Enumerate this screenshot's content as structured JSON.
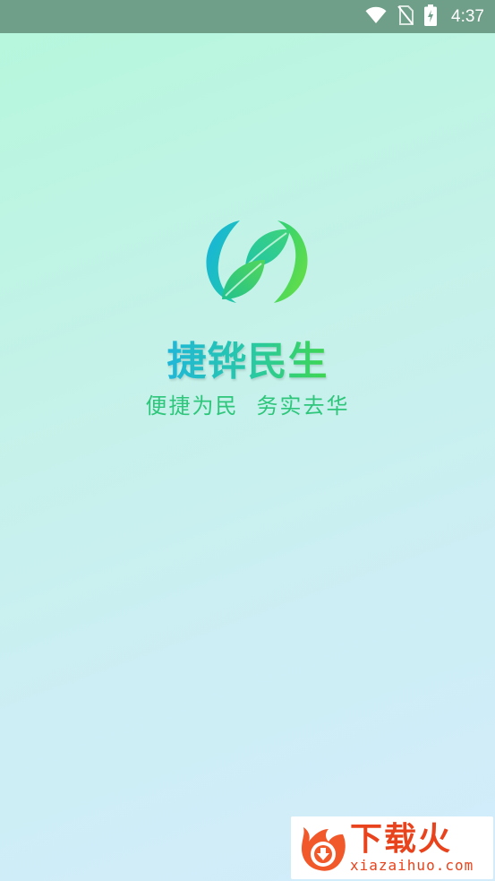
{
  "status_bar": {
    "time": "4:37",
    "icons": [
      "wifi-icon",
      "no-sim-icon",
      "battery-charging-icon"
    ]
  },
  "splash": {
    "app_name": "捷铧民生",
    "slogan_left": "便捷为民",
    "slogan_right": "务实去华",
    "colors": {
      "gradient_top": "#b6f7dd",
      "gradient_bottom": "#d2ecfb",
      "brand_blue": "#1fb7d9",
      "brand_green": "#3ed650",
      "slogan": "#2ec67a"
    }
  },
  "watermark": {
    "title": "下载火",
    "site": "xiazaihuo.com",
    "color": "#e8431c"
  }
}
